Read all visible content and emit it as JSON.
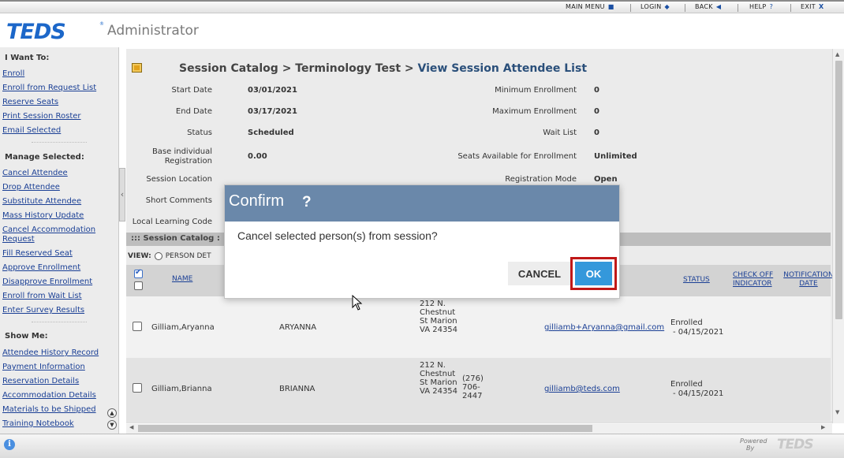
{
  "topnav": {
    "main_menu": "MAIN MENU",
    "login": "LOGIN",
    "back": "BACK",
    "help": "HELP",
    "exit": "EXIT"
  },
  "header": {
    "logo": "TEDS",
    "tm": "®",
    "subtitle": "Administrator"
  },
  "sidebar": {
    "i_want_to": "I Want To:",
    "want_links": [
      "Enroll",
      "Enroll from Request List",
      "Reserve Seats",
      "Print Session Roster",
      "Email Selected"
    ],
    "manage_selected": "Manage Selected:",
    "manage_links": [
      "Cancel Attendee",
      "Drop Attendee",
      "Substitute Attendee",
      "Mass History Update",
      "Cancel Accommodation",
      "Request",
      "Fill Reserved Seat",
      "Approve Enrollment",
      "Disapprove Enrollment",
      "Enroll from Wait List",
      "Enter Survey Results"
    ],
    "show_me": "Show Me:",
    "show_links": [
      "Attendee History Record",
      "Payment Information",
      "Reservation Details",
      "Accommodation Details",
      "Materials to be Shipped",
      "Training Notebook"
    ]
  },
  "breadcrumb": {
    "part1": "Session Catalog",
    "sep": ">",
    "part2": "Terminology Test",
    "current": "View Session Attendee List"
  },
  "fields_left": [
    {
      "label": "Start Date",
      "value": "03/01/2021"
    },
    {
      "label": "End Date",
      "value": "03/17/2021"
    },
    {
      "label": "Status",
      "value": "Scheduled"
    },
    {
      "label": "Base individual Registration",
      "value": "0.00"
    },
    {
      "label": "Session Location",
      "value": ""
    },
    {
      "label": "Short Comments",
      "value": ""
    },
    {
      "label": "Local Learning Code",
      "value": ""
    }
  ],
  "fields_right": [
    {
      "label": "Minimum Enrollment",
      "value": "0"
    },
    {
      "label": "Maximum Enrollment",
      "value": "0"
    },
    {
      "label": "Wait List",
      "value": "0"
    },
    {
      "label": "Seats Available for Enrollment",
      "value": "Unlimited"
    },
    {
      "label": "Registration Mode",
      "value": "Open"
    }
  ],
  "section": {
    "title": "::: Session Catalog :",
    "view_label": "VIEW:",
    "view_option": "PERSON DET"
  },
  "table": {
    "headers": {
      "name": "NAME",
      "status": "STATUS",
      "check_off": "CHECK OFF INDICATOR",
      "notification": "NOTIFICATION DATE"
    },
    "rows": [
      {
        "name": "Gilliam,Aryanna",
        "first": "ARYANNA",
        "address": "212 N. Chestnut St Marion VA 24354",
        "phone": "",
        "email": "gilliamb+Aryanna@gmail.com",
        "status": "Enrolled",
        "status_date": "- 04/15/2021"
      },
      {
        "name": "Gilliam,Brianna",
        "first": "BRIANNA",
        "address": "212 N. Chestnut St Marion VA 24354",
        "phone": "(276) 706- 2447",
        "email": "gilliamb@teds.com",
        "status": "Enrolled",
        "status_date": "- 04/15/2021"
      }
    ]
  },
  "modal": {
    "title": "Confirm",
    "title_icon": "?",
    "message": "Cancel selected person(s) from session?",
    "cancel_label": "CANCEL",
    "ok_label": "OK",
    "ok_color": "#3498db",
    "highlight_color": "#c01818"
  },
  "footer": {
    "powered": "Powered",
    "by": "By",
    "logo": "TEDS"
  }
}
